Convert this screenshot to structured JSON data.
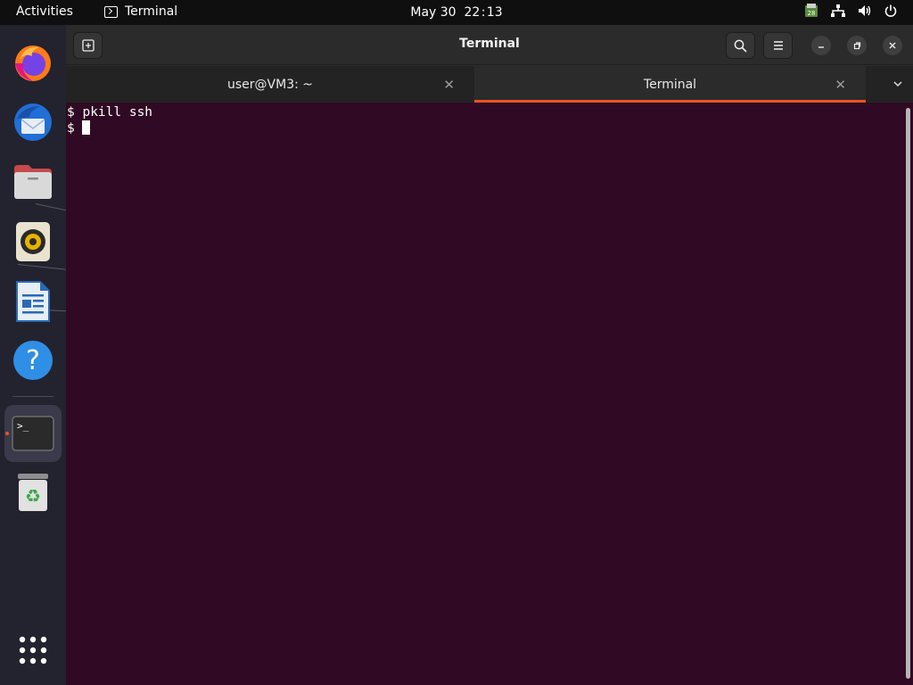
{
  "topbar": {
    "activities": "Activities",
    "app_name": "Terminal",
    "date": "May 30",
    "time": "22 : 13",
    "tray_icons": [
      "software-update-icon",
      "network-icon",
      "volume-icon",
      "power-icon"
    ]
  },
  "dock": {
    "items": [
      {
        "name": "Firefox",
        "icon": "firefox-icon"
      },
      {
        "name": "Thunderbird",
        "icon": "thunderbird-icon"
      },
      {
        "name": "Files",
        "icon": "files-icon"
      },
      {
        "name": "Rhythmbox",
        "icon": "rhythmbox-icon"
      },
      {
        "name": "LibreOffice Writer",
        "icon": "writer-icon"
      },
      {
        "name": "Help",
        "icon": "help-icon"
      },
      {
        "name": "Terminal",
        "icon": "terminal-icon",
        "active": true
      },
      {
        "name": "Trash",
        "icon": "trash-icon"
      }
    ],
    "apps_grid": "show-applications-icon"
  },
  "window": {
    "title": "Terminal",
    "tabs": [
      {
        "label": "user@VM3: ~",
        "active": false
      },
      {
        "label": "Terminal",
        "active": true
      }
    ]
  },
  "terminal": {
    "lines": [
      "$ pkill ssh",
      "$ "
    ]
  },
  "colors": {
    "accent": "#e95420",
    "terminal_bg": "#300a24",
    "topbar_bg": "#0f0f0f"
  }
}
